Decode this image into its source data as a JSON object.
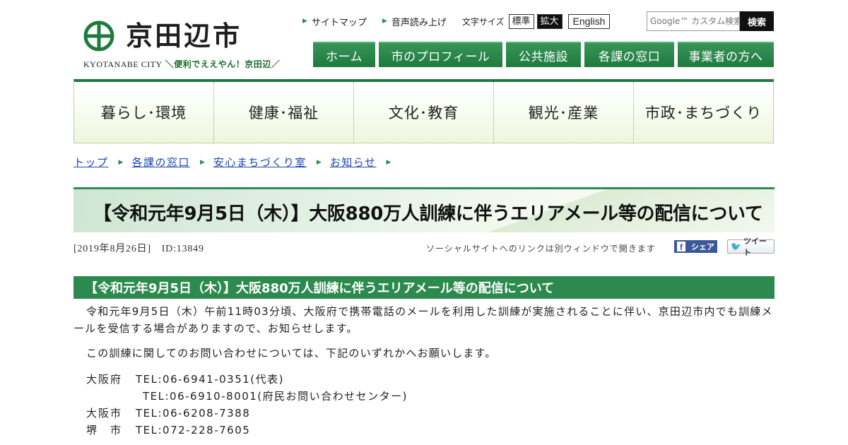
{
  "header": {
    "logo_text": "京田辺市",
    "logo_en": "KYOTANABE CITY",
    "tagline": "＼便利でええやん！京田辺／"
  },
  "utility": {
    "sitemap": "サイトマップ",
    "read_aloud": "音声読み上げ",
    "font_size_label": "文字サイズ",
    "font_standard": "標準",
    "font_large": "拡大",
    "english": "English",
    "search_placeholder": "Google™ カスタム検索",
    "search_button": "検索"
  },
  "topnav": [
    {
      "label": "ホーム"
    },
    {
      "label": "市のプロフィール"
    },
    {
      "label": "公共施設"
    },
    {
      "label": "各課の窓口"
    },
    {
      "label": "事業者の方へ"
    }
  ],
  "categories": [
    {
      "label": "暮らし･環境"
    },
    {
      "label": "健康･福祉"
    },
    {
      "label": "文化･教育"
    },
    {
      "label": "観光･産業"
    },
    {
      "label": "市政･まちづくり"
    }
  ],
  "breadcrumb": [
    {
      "label": "トップ"
    },
    {
      "label": "各課の窓口"
    },
    {
      "label": "安心まちづくり室"
    },
    {
      "label": "お知らせ"
    }
  ],
  "page": {
    "title": "【令和元年9月5日（木）】大阪880万人訓練に伴うエリアメール等の配信について",
    "date_id": "[2019年8月26日]　ID:13849",
    "social_note": "ソーシャルサイトへのリンクは別ウィンドウで開きます",
    "fb_share": "シェア",
    "tweet": "ツイート"
  },
  "section": {
    "heading": "【令和元年9月5日（木）】大阪880万人訓練に伴うエリアメール等の配信について",
    "para1": "令和元年9月5日（木）午前11時03分頃、大阪府で携帯電話のメールを利用した訓練が実施されることに伴い、京田辺市内でも訓練メールを受信する場合がありますので、お知らせします。",
    "para2": "この訓練に関してのお問い合わせについては、下記のいずれかへお願いします。",
    "contacts": [
      {
        "name": "大阪府",
        "tel": "TEL:06-6941-0351(代表)"
      },
      {
        "name": "",
        "tel": "TEL:06-6910-8001(府民お問い合わせセンター)"
      },
      {
        "name": "大阪市",
        "tel": "TEL:06-6208-7388"
      },
      {
        "name": "堺　市",
        "tel": "TEL:072-228-7605"
      }
    ]
  },
  "colors": {
    "brand_green": "#1f7a3e",
    "heading_green": "#2d8a4e",
    "link_blue": "#1a44b8"
  }
}
